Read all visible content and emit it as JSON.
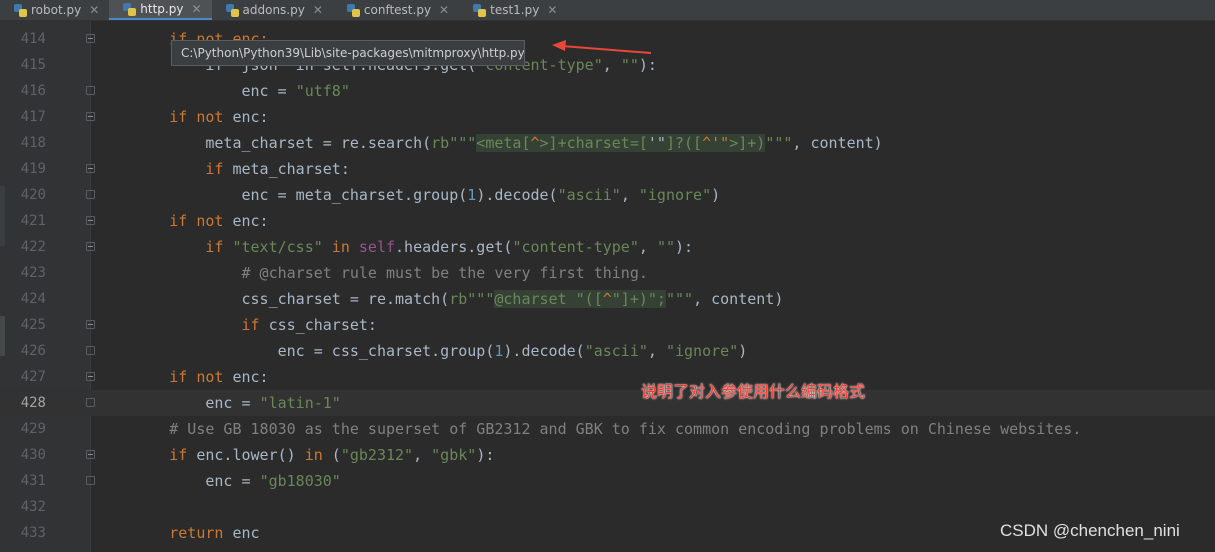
{
  "tabs": [
    {
      "label": "robot.py",
      "active": false
    },
    {
      "label": "http.py",
      "active": true
    },
    {
      "label": "addons.py",
      "active": false
    },
    {
      "label": "conftest.py",
      "active": false
    },
    {
      "label": "test1.py",
      "active": false
    }
  ],
  "tooltip_path": "C:\\Python\\Python39\\Lib\\site-packages\\mitmproxy\\http.py",
  "annotation_text": "说明了对入参使用什么编码格式",
  "watermark": "CSDN @chenchen_nini",
  "current_line": "428",
  "lines": [
    {
      "n": "414"
    },
    {
      "n": "415"
    },
    {
      "n": "416"
    },
    {
      "n": "417"
    },
    {
      "n": "418"
    },
    {
      "n": "419"
    },
    {
      "n": "420"
    },
    {
      "n": "421"
    },
    {
      "n": "422"
    },
    {
      "n": "423"
    },
    {
      "n": "424"
    },
    {
      "n": "425"
    },
    {
      "n": "426"
    },
    {
      "n": "427"
    },
    {
      "n": "428"
    },
    {
      "n": "429"
    },
    {
      "n": "430"
    },
    {
      "n": "431"
    },
    {
      "n": "432"
    },
    {
      "n": "433"
    }
  ],
  "code": {
    "l414": [
      "        ",
      "if not enc:"
    ],
    "l415": [
      "            ",
      "if \"json\" in self.headers.get(",
      "\"content-type\"",
      ", ",
      "\"\"",
      "):"
    ],
    "l416": [
      "                ",
      "enc = ",
      "\"utf8\""
    ],
    "l417": [
      "        ",
      "if not",
      " enc:"
    ],
    "l418": [
      "            ",
      "meta_charset = re.search(",
      "rb\"\"\"",
      "<meta[",
      "^",
      ">]+charset=[",
      "'\"",
      "]?([",
      "^'\"",
      ">]+)",
      "\"\"\"",
      ", content)"
    ],
    "l419": [
      "            ",
      "if",
      " meta_charset:"
    ],
    "l420": [
      "                ",
      "enc = meta_charset.group(",
      "1",
      ").decode(",
      "\"ascii\"",
      ", ",
      "\"ignore\"",
      ")"
    ],
    "l421": [
      "        ",
      "if not",
      " enc:"
    ],
    "l422": [
      "            ",
      "if ",
      "\"text/css\"",
      " in ",
      "self",
      ".headers.get(",
      "\"content-type\"",
      ", ",
      "\"\"",
      "):"
    ],
    "l423": [
      "                ",
      "# @charset rule must be the very first thing."
    ],
    "l424": [
      "                ",
      "css_charset = re.match(",
      "rb\"\"\"",
      "@charset \"([",
      "^",
      "\"]+)\";",
      "\"\"\"",
      ", content)"
    ],
    "l425": [
      "                ",
      "if",
      " css_charset:"
    ],
    "l426": [
      "                    ",
      "enc = css_charset.group(",
      "1",
      ").decode(",
      "\"ascii\"",
      ", ",
      "\"ignore\"",
      ")"
    ],
    "l427": [
      "        ",
      "if not",
      " enc:"
    ],
    "l428": [
      "            ",
      "enc = ",
      "\"latin-1\""
    ],
    "l429": [
      "        ",
      "# Use GB 18030 as the superset of GB2312 and GBK to fix common encoding problems on Chinese websites."
    ],
    "l430": [
      "        ",
      "if",
      " enc.lower() ",
      "in",
      " (",
      "\"gb2312\"",
      ", ",
      "\"gbk\"",
      "):"
    ],
    "l431": [
      "            ",
      "enc = ",
      "\"gb18030\""
    ],
    "l432": [
      ""
    ],
    "l433": [
      "        ",
      "return",
      " enc"
    ]
  }
}
